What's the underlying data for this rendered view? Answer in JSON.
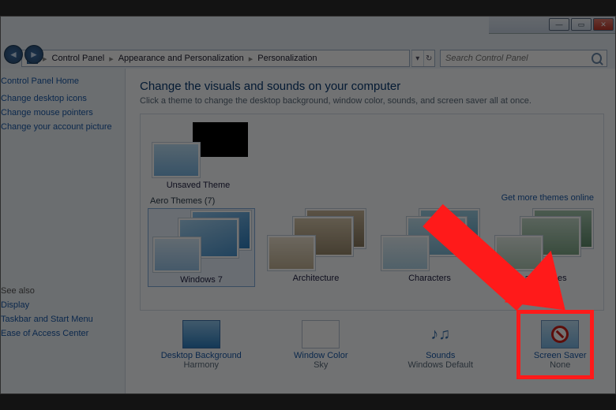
{
  "breadcrumb": {
    "root": "Control Panel",
    "mid": "Appearance and Personalization",
    "leaf": "Personalization"
  },
  "search": {
    "placeholder": "Search Control Panel"
  },
  "sidebar": {
    "home": "Control Panel Home",
    "links": [
      "Change desktop icons",
      "Change mouse pointers",
      "Change your account picture"
    ],
    "see_also": "See also",
    "also_links": [
      "Display",
      "Taskbar and Start Menu",
      "Ease of Access Center"
    ]
  },
  "main": {
    "heading": "Change the visuals and sounds on your computer",
    "sub": "Click a theme to change the desktop background, window color, sounds, and screen saver all at once.",
    "unsaved_theme": "Unsaved Theme",
    "aero_label": "Aero Themes (7)",
    "more_link": "Get more themes online",
    "aero": [
      "Windows 7",
      "Architecture",
      "Characters",
      "Landscapes"
    ]
  },
  "bottom": {
    "desktop": {
      "label": "Desktop Background",
      "value": "Harmony"
    },
    "color": {
      "label": "Window Color",
      "value": "Sky"
    },
    "sounds": {
      "label": "Sounds",
      "value": "Windows Default"
    },
    "saver": {
      "label": "Screen Saver",
      "value": "None"
    }
  }
}
